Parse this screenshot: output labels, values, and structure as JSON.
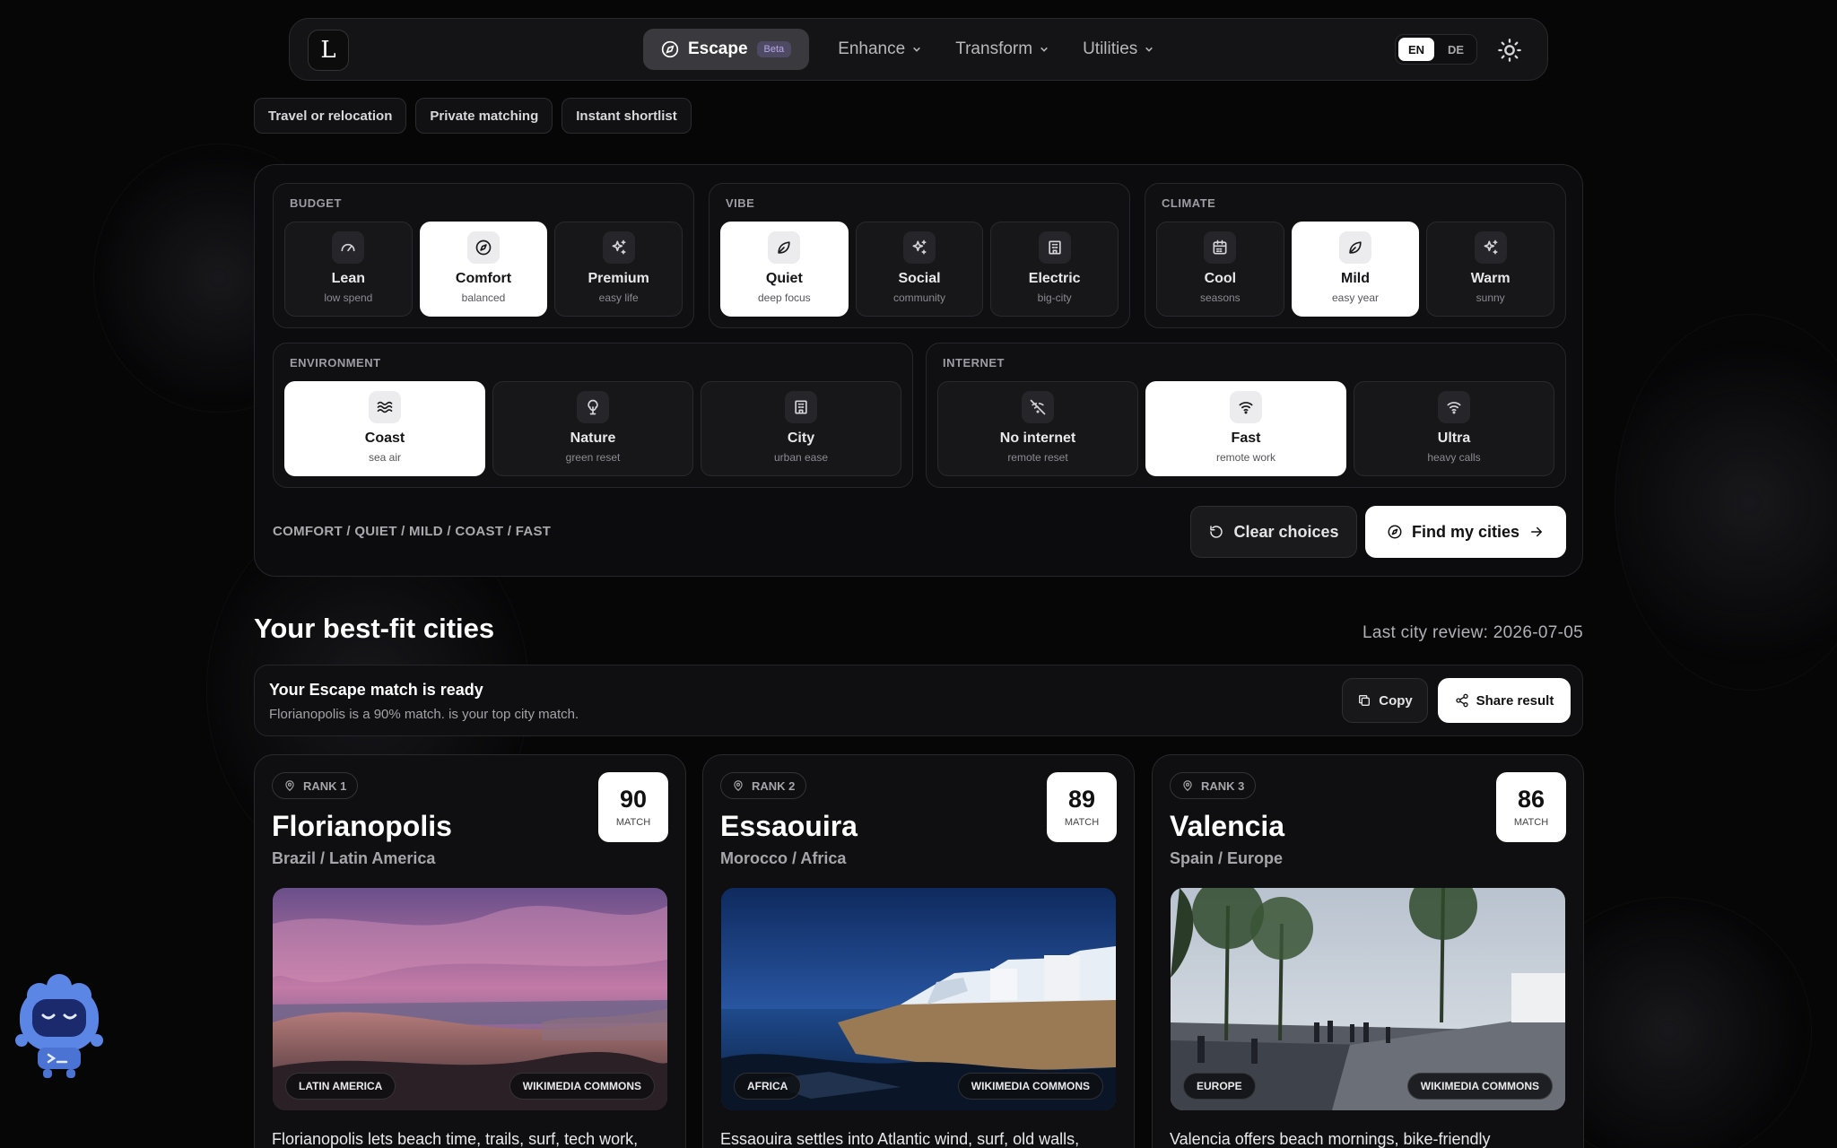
{
  "nav": {
    "logo": "L",
    "escape_label": "Escape",
    "beta_label": "Beta",
    "items": [
      {
        "label": "Enhance"
      },
      {
        "label": "Transform"
      },
      {
        "label": "Utilities"
      }
    ],
    "lang": {
      "en": "EN",
      "de": "DE",
      "active": "EN"
    }
  },
  "chips": [
    "Travel or relocation",
    "Private matching",
    "Instant shortlist"
  ],
  "panel": {
    "budget": {
      "title": "BUDGET",
      "options": [
        {
          "label": "Lean",
          "sub": "low spend",
          "icon": "gauge-icon",
          "active": false
        },
        {
          "label": "Comfort",
          "sub": "balanced",
          "icon": "compass-icon",
          "active": true
        },
        {
          "label": "Premium",
          "sub": "easy life",
          "icon": "sparkles-icon",
          "active": false
        }
      ]
    },
    "vibe": {
      "title": "VIBE",
      "options": [
        {
          "label": "Quiet",
          "sub": "deep focus",
          "icon": "leaf-icon",
          "active": true
        },
        {
          "label": "Social",
          "sub": "community",
          "icon": "sparkles-icon",
          "active": false
        },
        {
          "label": "Electric",
          "sub": "big-city",
          "icon": "building-icon",
          "active": false
        }
      ]
    },
    "climate": {
      "title": "CLIMATE",
      "options": [
        {
          "label": "Cool",
          "sub": "seasons",
          "icon": "calendar-icon",
          "active": false
        },
        {
          "label": "Mild",
          "sub": "easy year",
          "icon": "leaf-icon",
          "active": true
        },
        {
          "label": "Warm",
          "sub": "sunny",
          "icon": "sparkles-icon",
          "active": false
        }
      ]
    },
    "environment": {
      "title": "ENVIRONMENT",
      "options": [
        {
          "label": "Coast",
          "sub": "sea air",
          "icon": "waves-icon",
          "active": true
        },
        {
          "label": "Nature",
          "sub": "green reset",
          "icon": "tree-icon",
          "active": false
        },
        {
          "label": "City",
          "sub": "urban ease",
          "icon": "building-icon",
          "active": false
        }
      ]
    },
    "internet": {
      "title": "INTERNET",
      "options": [
        {
          "label": "No internet",
          "sub": "remote reset",
          "icon": "wifi-off-icon",
          "active": false
        },
        {
          "label": "Fast",
          "sub": "remote work",
          "icon": "wifi-icon",
          "active": true
        },
        {
          "label": "Ultra",
          "sub": "heavy calls",
          "icon": "wifi-icon",
          "active": false
        }
      ]
    },
    "summary": "COMFORT / QUIET / MILD / COAST / FAST",
    "clear_label": "Clear choices",
    "find_label": "Find my cities"
  },
  "results": {
    "title": "Your best-fit cities",
    "last_review": "Last city review: 2026-07-05",
    "banner_title": "Your Escape match is ready",
    "banner_sub": "Florianopolis is a 90% match. is your top city match.",
    "copy_label": "Copy",
    "share_label": "Share result",
    "cards": [
      {
        "rank": "RANK 1",
        "score": "90",
        "score_label": "MATCH",
        "name": "Florianopolis",
        "region": "Brazil / Latin America",
        "tag": "LATIN AMERICA",
        "credit": "WIKIMEDIA COMMONS",
        "desc": "Florianopolis lets beach time, trails, surf, tech work,"
      },
      {
        "rank": "RANK 2",
        "score": "89",
        "score_label": "MATCH",
        "name": "Essaouira",
        "region": "Morocco / Africa",
        "tag": "AFRICA",
        "credit": "WIKIMEDIA COMMONS",
        "desc": "Essaouira settles into Atlantic wind, surf, old walls,"
      },
      {
        "rank": "RANK 3",
        "score": "86",
        "score_label": "MATCH",
        "name": "Valencia",
        "region": "Spain / Europe",
        "tag": "EUROPE",
        "credit": "WIKIMEDIA COMMONS",
        "desc": "Valencia offers beach mornings, bike-friendly"
      }
    ]
  }
}
